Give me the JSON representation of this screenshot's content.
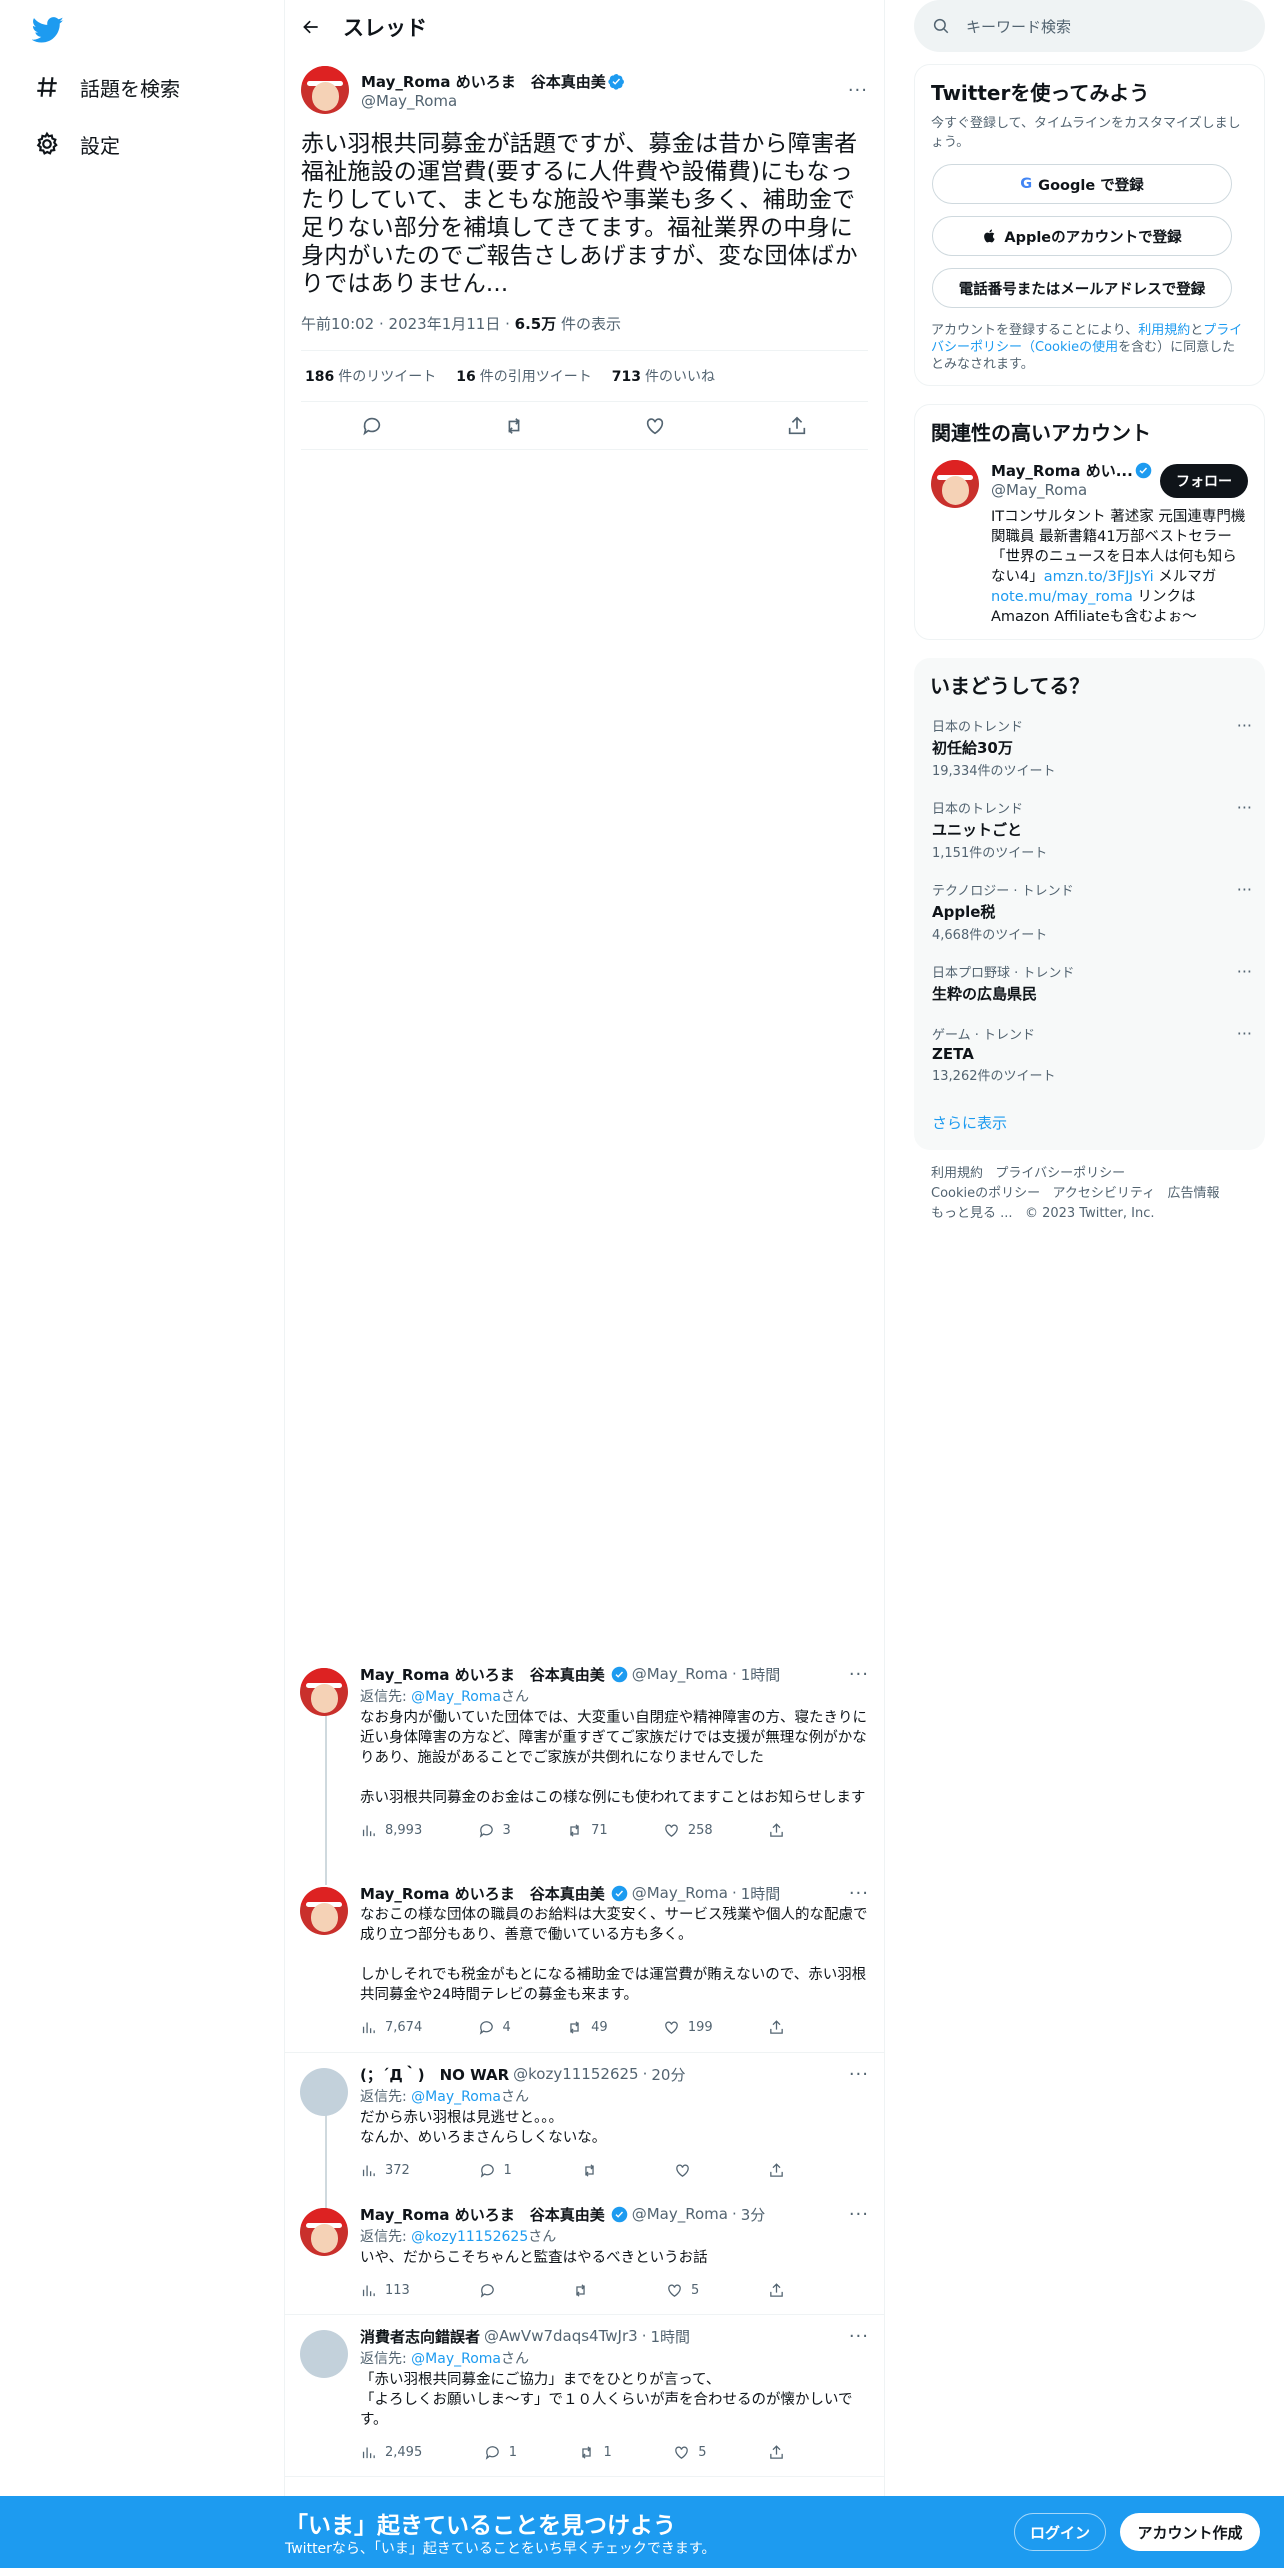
{
  "nav": {
    "explore_label": "話題を検索",
    "settings_label": "設定"
  },
  "thread_header": {
    "title": "スレッド"
  },
  "main_tweet": {
    "name": "May_Roma めいろま　谷本真由美",
    "handle": "@May_Roma",
    "text": "赤い羽根共同募金が話題ですが、募金は昔から障害者福祉施設の運営費(要するに人件費や設備費)にもなったりしていて、まともな施設や事業も多く、補助金で足りない部分を補填してきてます。福祉業界の中身に身内がいたのでご報告さしあげますが、変な団体ばかりではありません...",
    "time": "午前10:02",
    "date": "2023年1月11日",
    "views_count": "6.5万",
    "views_label": "件の表示",
    "retweets": "186",
    "retweets_label": "件のリツイート",
    "quotes": "16",
    "quotes_label": "件の引用ツイート",
    "likes": "713",
    "likes_label": "件のいいね"
  },
  "replies": [
    {
      "name": "May_Roma めいろま　谷本真由美",
      "handle": "@May_Roma",
      "time": "1時間",
      "reply_to_prefix": "返信先: ",
      "reply_to": "@May_Roma",
      "reply_to_suffix": "さん",
      "text": "なお身内が働いていた団体では、大変重い自閉症や精神障害の方、寝たきりに近い身体障害の方など、障害が重すぎてご家族だけでは支援が無理な例がかなりあり、施設があることでご家族が共倒れになりませんでした\n\n赤い羽根共同募金のお金はこの様な例にも使われてますことはお知らせします",
      "views": "8,993",
      "replies": "3",
      "retweets": "71",
      "likes": "258"
    },
    {
      "name": "May_Roma めいろま　谷本真由美",
      "handle": "@May_Roma",
      "time": "1時間",
      "text": "なおこの様な団体の職員のお給料は大変安く、サービス残業や個人的な配慮で成り立つ部分もあり、善意で働いている方も多く。\n\nしかしそれでも税金がもとになる補助金では運営費が賄えないので、赤い羽根共同募金や24時間テレビの募金も来ます。",
      "views": "7,674",
      "replies": "4",
      "retweets": "49",
      "likes": "199"
    },
    {
      "name": "(；´Д｀)　NO WAR",
      "handle": "@kozy11152625",
      "time": "20分",
      "reply_to_prefix": "返信先: ",
      "reply_to": "@May_Roma",
      "reply_to_suffix": "さん",
      "text": "だから赤い羽根は見逃せと。。。\nなんか、めいろまさんらしくないな。",
      "views": "372",
      "replies": "1",
      "retweets": "",
      "likes": ""
    },
    {
      "name": "May_Roma めいろま　谷本真由美",
      "handle": "@May_Roma",
      "time": "3分",
      "reply_to_prefix": "返信先: ",
      "reply_to": "@kozy11152625",
      "reply_to_suffix": "さん",
      "text": "いや、だからこそちゃんと監査はやるべきというお話",
      "views": "113",
      "replies": "",
      "retweets": "",
      "likes": "5"
    },
    {
      "name": "消費者志向錯誤者",
      "handle": "@AwVw7daqs4TwJr3",
      "time": "1時間",
      "reply_to_prefix": "返信先: ",
      "reply_to": "@May_Roma",
      "reply_to_suffix": "さん",
      "text": "「赤い羽根共同募金にご協力」までをひとりが言って、\n「よろしくお願いしま～す」で１０人くらいが声を合わせるのが懐かしいです。",
      "views": "2,495",
      "replies": "1",
      "retweets": "1",
      "likes": "5"
    }
  ],
  "search": {
    "placeholder": "キーワード検索"
  },
  "signup": {
    "title": "Twitterを使ってみよう",
    "subtitle": "今すぐ登録して、タイムラインをカスタマイズしましょう。",
    "google": "Google で登録",
    "apple": "Appleのアカウントで登録",
    "phone": "電話番号またはメールアドレスで登録",
    "terms_1": "アカウントを登録することにより、",
    "terms_link1": "利用規約",
    "terms_2": "と",
    "terms_link2": "プライバシーポリシー（Cookieの使用",
    "terms_3": "を含む）に同意したとみなされます。"
  },
  "related": {
    "title": "関連性の高いアカウント",
    "name": "May_Roma めい...",
    "handle": "@May_Roma",
    "follow": "フォロー",
    "bio_1": "ITコンサルタント 著述家 元国連専門機関職員 最新書籍41万部ベストセラー「世界のニュースを日本人は何も知らない4」",
    "bio_link1": "amzn.to/3FJJsYi",
    "bio_2": " メルマガ ",
    "bio_link2": "note.mu/may_roma",
    "bio_3": " リンクはAmazon Affiliateも含むよぉ〜"
  },
  "trends": {
    "title": "いまどうしてる？",
    "items": [
      {
        "category": "日本のトレンド",
        "topic": "初任給30万",
        "count": "19,334件のツイート"
      },
      {
        "category": "日本のトレンド",
        "topic": "ユニットごと",
        "count": "1,151件のツイート"
      },
      {
        "category": "テクノロジー · トレンド",
        "topic": "Apple税",
        "count": "4,668件のツイート"
      },
      {
        "category": "日本プロ野球 · トレンド",
        "topic": "生粋の広島県民",
        "count": ""
      },
      {
        "category": "ゲーム · トレンド",
        "topic": "ZETA",
        "count": "13,262件のツイート"
      }
    ],
    "more": "さらに表示"
  },
  "footer": {
    "terms": "利用規約",
    "privacy": "プライバシーポリシー",
    "cookie": "Cookieのポリシー",
    "access": "アクセシビリティ",
    "ads": "広告情報",
    "more": "もっと見る ...",
    "copyright": "© 2023 Twitter, Inc."
  },
  "bottom_bar": {
    "title": "「いま」起きていることを見つけよう",
    "subtitle": "Twitterなら、「いま」起きていることをいち早くチェックできます。",
    "login": "ログイン",
    "signup": "アカウント作成"
  },
  "colors": {
    "accent": "#1d9bf0",
    "text": "#0f1419",
    "muted": "#536471"
  }
}
